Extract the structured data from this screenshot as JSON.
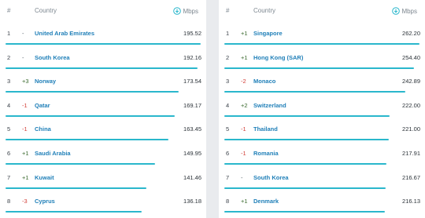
{
  "left": {
    "header": {
      "rank": "#",
      "country": "Country",
      "unit": "Mbps"
    },
    "rows": [
      {
        "rank": "1",
        "change": "-",
        "dir": "same",
        "country": "United Arab Emirates",
        "speed": "195.52",
        "fraction": 1.0
      },
      {
        "rank": "2",
        "change": "-",
        "dir": "same",
        "country": "South Korea",
        "speed": "192.16",
        "fraction": 0.983
      },
      {
        "rank": "3",
        "change": "+3",
        "dir": "up",
        "country": "Norway",
        "speed": "173.54",
        "fraction": 0.888
      },
      {
        "rank": "4",
        "change": "-1",
        "dir": "down",
        "country": "Qatar",
        "speed": "169.17",
        "fraction": 0.865
      },
      {
        "rank": "5",
        "change": "-1",
        "dir": "down",
        "country": "China",
        "speed": "163.45",
        "fraction": 0.836
      },
      {
        "rank": "6",
        "change": "+1",
        "dir": "up",
        "country": "Saudi Arabia",
        "speed": "149.95",
        "fraction": 0.767
      },
      {
        "rank": "7",
        "change": "+1",
        "dir": "up",
        "country": "Kuwait",
        "speed": "141.46",
        "fraction": 0.723
      },
      {
        "rank": "8",
        "change": "-3",
        "dir": "down",
        "country": "Cyprus",
        "speed": "136.18",
        "fraction": 0.696
      }
    ]
  },
  "right": {
    "header": {
      "rank": "#",
      "country": "Country",
      "unit": "Mbps"
    },
    "rows": [
      {
        "rank": "1",
        "change": "+1",
        "dir": "up",
        "country": "Singapore",
        "speed": "262.20",
        "fraction": 1.0
      },
      {
        "rank": "2",
        "change": "+1",
        "dir": "up",
        "country": "Hong Kong (SAR)",
        "speed": "254.40",
        "fraction": 0.97
      },
      {
        "rank": "3",
        "change": "-2",
        "dir": "down",
        "country": "Monaco",
        "speed": "242.89",
        "fraction": 0.926
      },
      {
        "rank": "4",
        "change": "+2",
        "dir": "up",
        "country": "Switzerland",
        "speed": "222.00",
        "fraction": 0.847
      },
      {
        "rank": "5",
        "change": "-1",
        "dir": "down",
        "country": "Thailand",
        "speed": "221.00",
        "fraction": 0.843
      },
      {
        "rank": "6",
        "change": "-1",
        "dir": "down",
        "country": "Romania",
        "speed": "217.91",
        "fraction": 0.831
      },
      {
        "rank": "7",
        "change": "-",
        "dir": "same",
        "country": "South Korea",
        "speed": "216.67",
        "fraction": 0.826
      },
      {
        "rank": "8",
        "change": "+1",
        "dir": "up",
        "country": "Denmark",
        "speed": "216.13",
        "fraction": 0.824
      }
    ]
  },
  "colors": {
    "bar": "#2ab7cc",
    "country_link": "#1f7fb8",
    "up": "#3b6a2f",
    "down": "#d23c35"
  },
  "icons": {
    "unit_icon": "download-circle-icon"
  }
}
